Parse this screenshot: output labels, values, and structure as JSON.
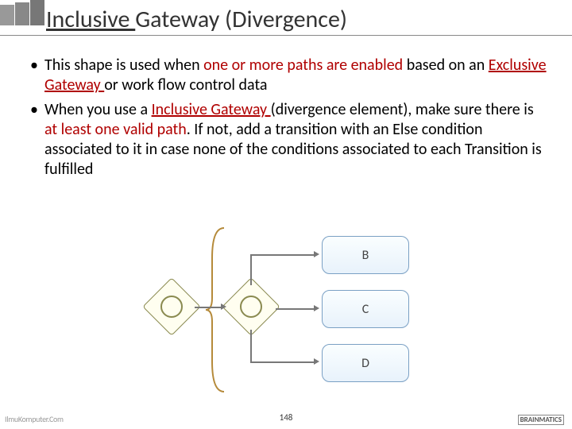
{
  "title": {
    "part1": "Inclusive ",
    "part2": "Gateway (Divergence)"
  },
  "bullets": [
    {
      "pre": "This shape is used when ",
      "hl1": "one or more paths are enabled ",
      "mid": "based on an ",
      "hl2": "Exclusive Gateway ",
      "post": "or work flow control data"
    },
    {
      "pre": "When you use a ",
      "hl1": "Inclusive Gateway ",
      "mid": "(divergence element), make sure there is ",
      "hl2": "at least one valid path",
      "post": ". If not, add a transition with an Else condition associated to it in case none of the conditions associated to each Transition is fulfilled"
    }
  ],
  "diagram": {
    "tasks": {
      "b": "B",
      "c": "C",
      "d": "D"
    }
  },
  "footer": {
    "page": "148",
    "left": "IlmuKomputer.Com",
    "right": "BRAINMATICS"
  }
}
